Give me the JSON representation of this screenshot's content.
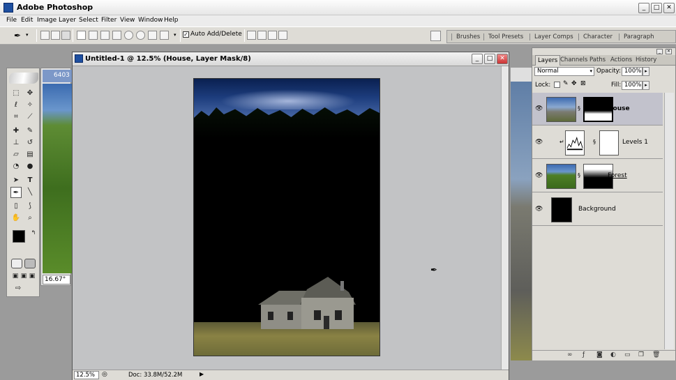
{
  "app": {
    "title": "Adobe Photoshop"
  },
  "window_controls": {
    "minimize": "_",
    "maximize": "□",
    "close": "✕"
  },
  "menu": [
    "File",
    "Edit",
    "Image",
    "Layer",
    "Select",
    "Filter",
    "View",
    "Window",
    "Help"
  ],
  "options_bar": {
    "auto_add_delete_label": "Auto Add/Delete",
    "auto_add_delete_checked": true,
    "palette_wells": [
      "Brushes",
      "Tool Presets",
      "Layer Comps",
      "Character",
      "Paragraph"
    ]
  },
  "background_doc_left": {
    "title": "6403",
    "zoom": "16.67°"
  },
  "document": {
    "title": "Untitled-1 @ 12.5% (House, Layer Mask/8)",
    "zoom": "12.5%",
    "doc_size": "Doc: 33.8M/52.2M"
  },
  "layers_palette": {
    "tabs": [
      "Layers",
      "Channels",
      "Paths",
      "Actions",
      "History"
    ],
    "active_tab": "Layers",
    "blend_mode": "Normal",
    "opacity_label": "Opacity:",
    "opacity_value": "100%",
    "lock_label": "Lock:",
    "fill_label": "Fill:",
    "fill_value": "100%",
    "layers": [
      {
        "name": "House",
        "visible": true,
        "selected": true,
        "bold": true
      },
      {
        "name": "Levels 1",
        "visible": true,
        "selected": false,
        "adjustment": true,
        "clipped": true
      },
      {
        "name": "Forest",
        "visible": true,
        "selected": false,
        "underlined": true
      },
      {
        "name": "Background",
        "visible": true,
        "selected": false
      }
    ]
  },
  "colors": {
    "foreground": "#000000",
    "background": "#ffffff",
    "selected_layer": "#c2c2cc"
  }
}
